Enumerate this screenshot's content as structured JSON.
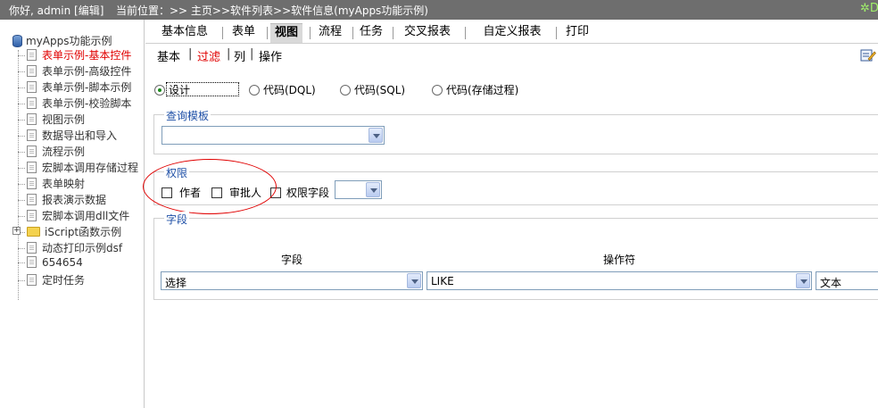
{
  "topbar": {
    "greeting": "你好, admin [编辑]",
    "breadcrumb": "当前位置：>> 主页>>软件列表>>软件信息(myApps功能示例)"
  },
  "sidebar": {
    "root": "myApps功能示例",
    "items": [
      {
        "label": "表单示例-基本控件",
        "active": true
      },
      {
        "label": "表单示例-高级控件"
      },
      {
        "label": "表单示例-脚本示例"
      },
      {
        "label": "表单示例-校验脚本"
      },
      {
        "label": "视图示例"
      },
      {
        "label": "数据导出和导入"
      },
      {
        "label": "流程示例"
      },
      {
        "label": "宏脚本调用存储过程"
      },
      {
        "label": "表单映射"
      },
      {
        "label": "报表演示数据"
      },
      {
        "label": "宏脚本调用dll文件"
      },
      {
        "label": "iScript函数示例",
        "folder": true
      },
      {
        "label": "动态打印示例dsf"
      },
      {
        "label": "654654"
      },
      {
        "label": "定时任务"
      }
    ]
  },
  "tabs": [
    {
      "label": "基本信息"
    },
    {
      "label": "表单"
    },
    {
      "label": "视图",
      "selected": true
    },
    {
      "label": "流程"
    },
    {
      "label": "任务"
    },
    {
      "label": "交叉报表"
    },
    {
      "label": "自定义报表"
    },
    {
      "label": "打印"
    }
  ],
  "subtabs": {
    "basic": "基本",
    "filter": "过滤",
    "columns": "列",
    "actions": "操作"
  },
  "radios": [
    {
      "label": "设计",
      "checked": true
    },
    {
      "label": "代码(DQL)"
    },
    {
      "label": "代码(SQL)"
    },
    {
      "label": "代码(存储过程)"
    }
  ],
  "query_template": {
    "legend": "查询模板",
    "value": ""
  },
  "permission": {
    "legend": "权限",
    "author": "作者",
    "approver": "审批人",
    "perm_field": "权限字段",
    "perm_field_value": ""
  },
  "fields": {
    "legend": "字段",
    "col_field": "字段",
    "col_operator": "操作符",
    "field_value": "选择",
    "operator_value": "LIKE",
    "type_value": "文本"
  },
  "colors": {
    "topbar": "#6e6e6e",
    "active": "#e00000",
    "legend": "#1e4fa6"
  }
}
